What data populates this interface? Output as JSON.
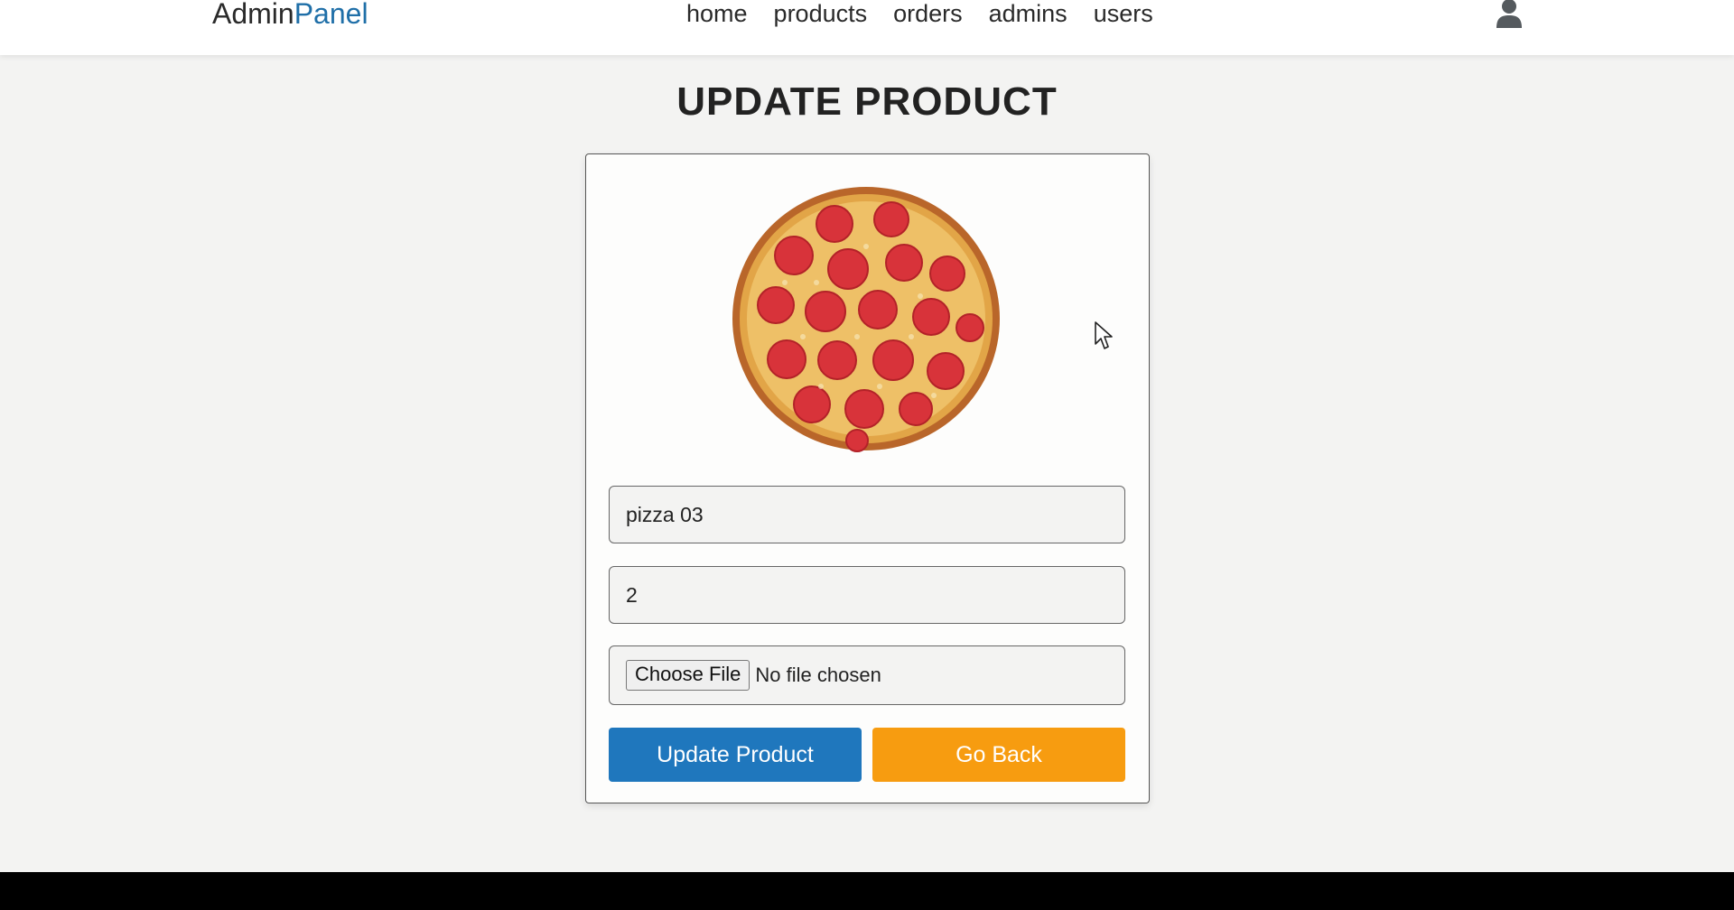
{
  "header": {
    "logo_main": "Admin",
    "logo_accent": "Panel",
    "nav": [
      "home",
      "products",
      "orders",
      "admins",
      "users"
    ],
    "user_icon": "user-icon"
  },
  "page": {
    "title": "UPDATE PRODUCT"
  },
  "form": {
    "image": "pepperoni-pizza-image",
    "name_value": "pizza 03",
    "price_value": "2",
    "file_button": "Choose File",
    "file_status": "No file chosen",
    "update_button": "Update Product",
    "back_button": "Go Back"
  },
  "colors": {
    "accent": "#1f6fa8",
    "update_button": "#1f77bd",
    "back_button": "#f79c10",
    "footer": "#000000"
  }
}
